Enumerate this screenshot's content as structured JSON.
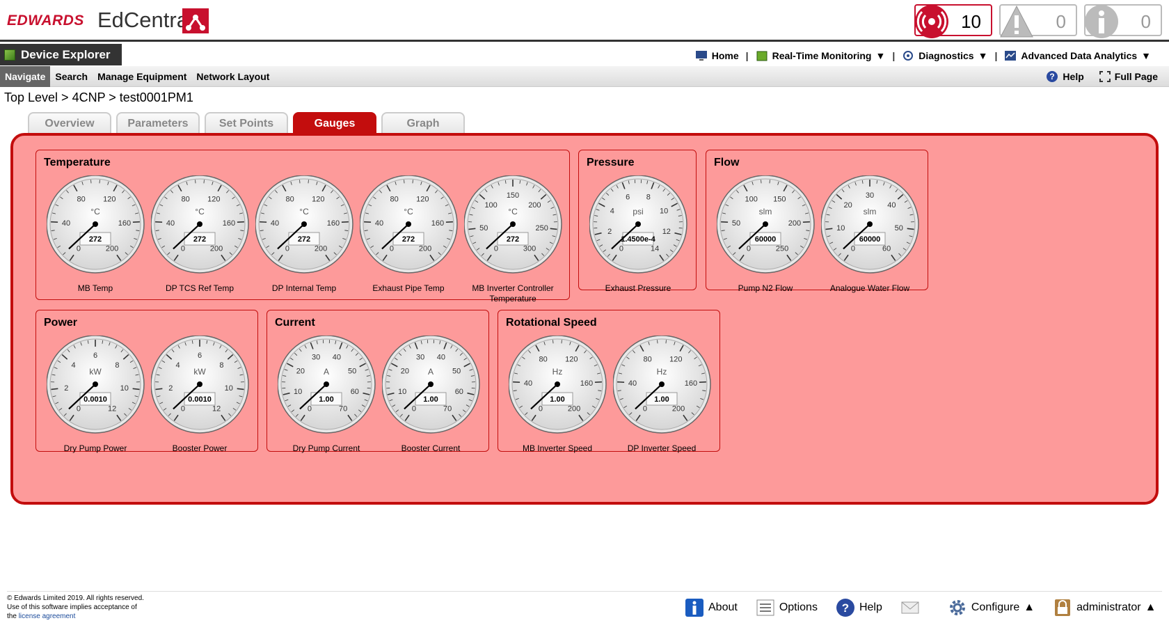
{
  "header": {
    "brand": "EDWARDS",
    "product": "EdCentra",
    "alarm_count": "10",
    "warning_count": "0",
    "info_count": "0",
    "colors": {
      "brand_red": "#c8102e",
      "panel_red": "#c30d0d",
      "panel_fill": "#fd9a9a"
    }
  },
  "title_bar": {
    "title": "Device Explorer"
  },
  "top_nav": {
    "home": "Home",
    "realtime": "Real-Time Monitoring",
    "diagnostics": "Diagnostics",
    "analytics": "Advanced Data Analytics",
    "sep": "|"
  },
  "sub_nav": {
    "navigate": "Navigate",
    "search": "Search",
    "manage": "Manage Equipment",
    "network": "Network Layout",
    "help": "Help",
    "full_page": "Full Page"
  },
  "breadcrumb": "Top Level > 4CNP > test0001PM1",
  "tabs": [
    "Overview",
    "Parameters",
    "Set Points",
    "Gauges",
    "Graph"
  ],
  "active_tab": "Gauges",
  "groups": [
    {
      "title": "Temperature",
      "gauges": [
        {
          "label": "MB Temp",
          "unit": "°C",
          "value": "272",
          "ticks": [
            "0",
            "40",
            "80",
            "120",
            "160",
            "200"
          ]
        },
        {
          "label": "DP TCS Ref Temp",
          "unit": "°C",
          "value": "272",
          "ticks": [
            "0",
            "40",
            "80",
            "120",
            "160",
            "200"
          ]
        },
        {
          "label": "DP Internal Temp",
          "unit": "°C",
          "value": "272",
          "ticks": [
            "0",
            "40",
            "80",
            "120",
            "160",
            "200"
          ]
        },
        {
          "label": "Exhaust Pipe Temp",
          "unit": "°C",
          "value": "272",
          "ticks": [
            "0",
            "40",
            "80",
            "120",
            "160",
            "200"
          ]
        },
        {
          "label": "MB Inverter Controller Temperature",
          "unit": "°C",
          "value": "272",
          "ticks": [
            "0",
            "50",
            "100",
            "150",
            "200",
            "250",
            "300"
          ]
        }
      ]
    },
    {
      "title": "Pressure",
      "gauges": [
        {
          "label": "Exhaust Pressure",
          "unit": "psi",
          "value": "1.4500e-4",
          "ticks": [
            "0",
            "2",
            "4",
            "6",
            "8",
            "10",
            "12",
            "14"
          ]
        }
      ]
    },
    {
      "title": "Flow",
      "gauges": [
        {
          "label": "Pump N2 Flow",
          "unit": "slm",
          "value": "60000",
          "ticks": [
            "0",
            "50",
            "100",
            "150",
            "200",
            "250"
          ]
        },
        {
          "label": "Analogue Water Flow",
          "unit": "slm",
          "value": "60000",
          "ticks": [
            "0",
            "10",
            "20",
            "30",
            "40",
            "50",
            "60"
          ]
        }
      ]
    },
    {
      "title": "Power",
      "gauges": [
        {
          "label": "Dry Pump Power",
          "unit": "kW",
          "value": "0.0010",
          "ticks": [
            "0",
            "2",
            "4",
            "6",
            "8",
            "10",
            "12"
          ]
        },
        {
          "label": "Booster Power",
          "unit": "kW",
          "value": "0.0010",
          "ticks": [
            "0",
            "2",
            "4",
            "6",
            "8",
            "10",
            "12"
          ]
        }
      ]
    },
    {
      "title": "Current",
      "gauges": [
        {
          "label": "Dry Pump Current",
          "unit": "A",
          "value": "1.00",
          "ticks": [
            "0",
            "10",
            "20",
            "30",
            "40",
            "50",
            "60",
            "70"
          ]
        },
        {
          "label": "Booster Current",
          "unit": "A",
          "value": "1.00",
          "ticks": [
            "0",
            "10",
            "20",
            "30",
            "40",
            "50",
            "60",
            "70"
          ]
        }
      ]
    },
    {
      "title": "Rotational Speed",
      "gauges": [
        {
          "label": "MB Inverter Speed",
          "unit": "Hz",
          "value": "1.00",
          "ticks": [
            "0",
            "40",
            "80",
            "120",
            "160",
            "200"
          ]
        },
        {
          "label": "DP Inverter Speed",
          "unit": "Hz",
          "value": "1.00",
          "ticks": [
            "0",
            "40",
            "80",
            "120",
            "160",
            "200"
          ]
        }
      ]
    }
  ],
  "footer": {
    "copyright_1": "© Edwards Limited 2019. All rights reserved.",
    "copyright_2": "Use of this software implies acceptance of",
    "copyright_3": "the",
    "license_link": "license agreement",
    "about": "About",
    "options": "Options",
    "help": "Help",
    "configure": "Configure",
    "user": "administrator"
  }
}
